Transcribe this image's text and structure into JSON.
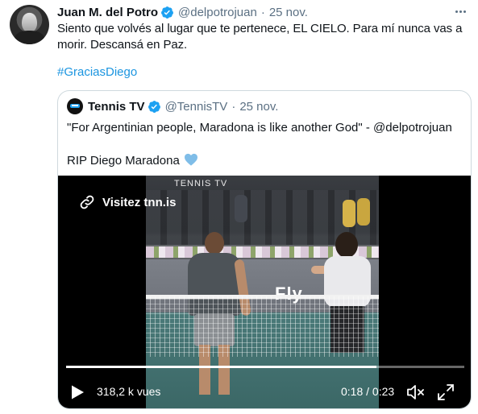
{
  "tweet": {
    "author_name": "Juan M. del Potro",
    "handle": "@delpotrojuan",
    "separator": "·",
    "date": "25 nov.",
    "text_lines": [
      "Siento que volvés al lugar que te pertenece, EL CIELO. Para mí nunca vas a",
      "morir. Descansá en Paz."
    ],
    "hashtag": "#GraciasDiego"
  },
  "quote": {
    "author_name": "Tennis TV",
    "handle": "@TennisTV",
    "separator": "·",
    "date": "25 nov.",
    "text_1": "\"For Argentinian people, Maradona is like another God\" - @delpotrojuan",
    "text_2": "RIP Diego Maradona"
  },
  "video": {
    "link_label": "Visitez tnn.is",
    "views": "318,2 k vues",
    "time": "0:18 / 0:23",
    "progress": 0.78,
    "overlay_top": "TENNIS TV",
    "overlay_banner": "Fly"
  },
  "colors": {
    "accent": "#1da1f2",
    "link": "#1b95e0",
    "muted": "#5b7083",
    "heart": "#7fbde8"
  },
  "icons": {
    "verified": "verified-badge-icon",
    "more": "more-options-icon",
    "heart": "blue-heart-icon",
    "link": "link-icon",
    "play": "play-icon",
    "volume": "volume-muted-icon",
    "fullscreen": "fullscreen-icon"
  }
}
